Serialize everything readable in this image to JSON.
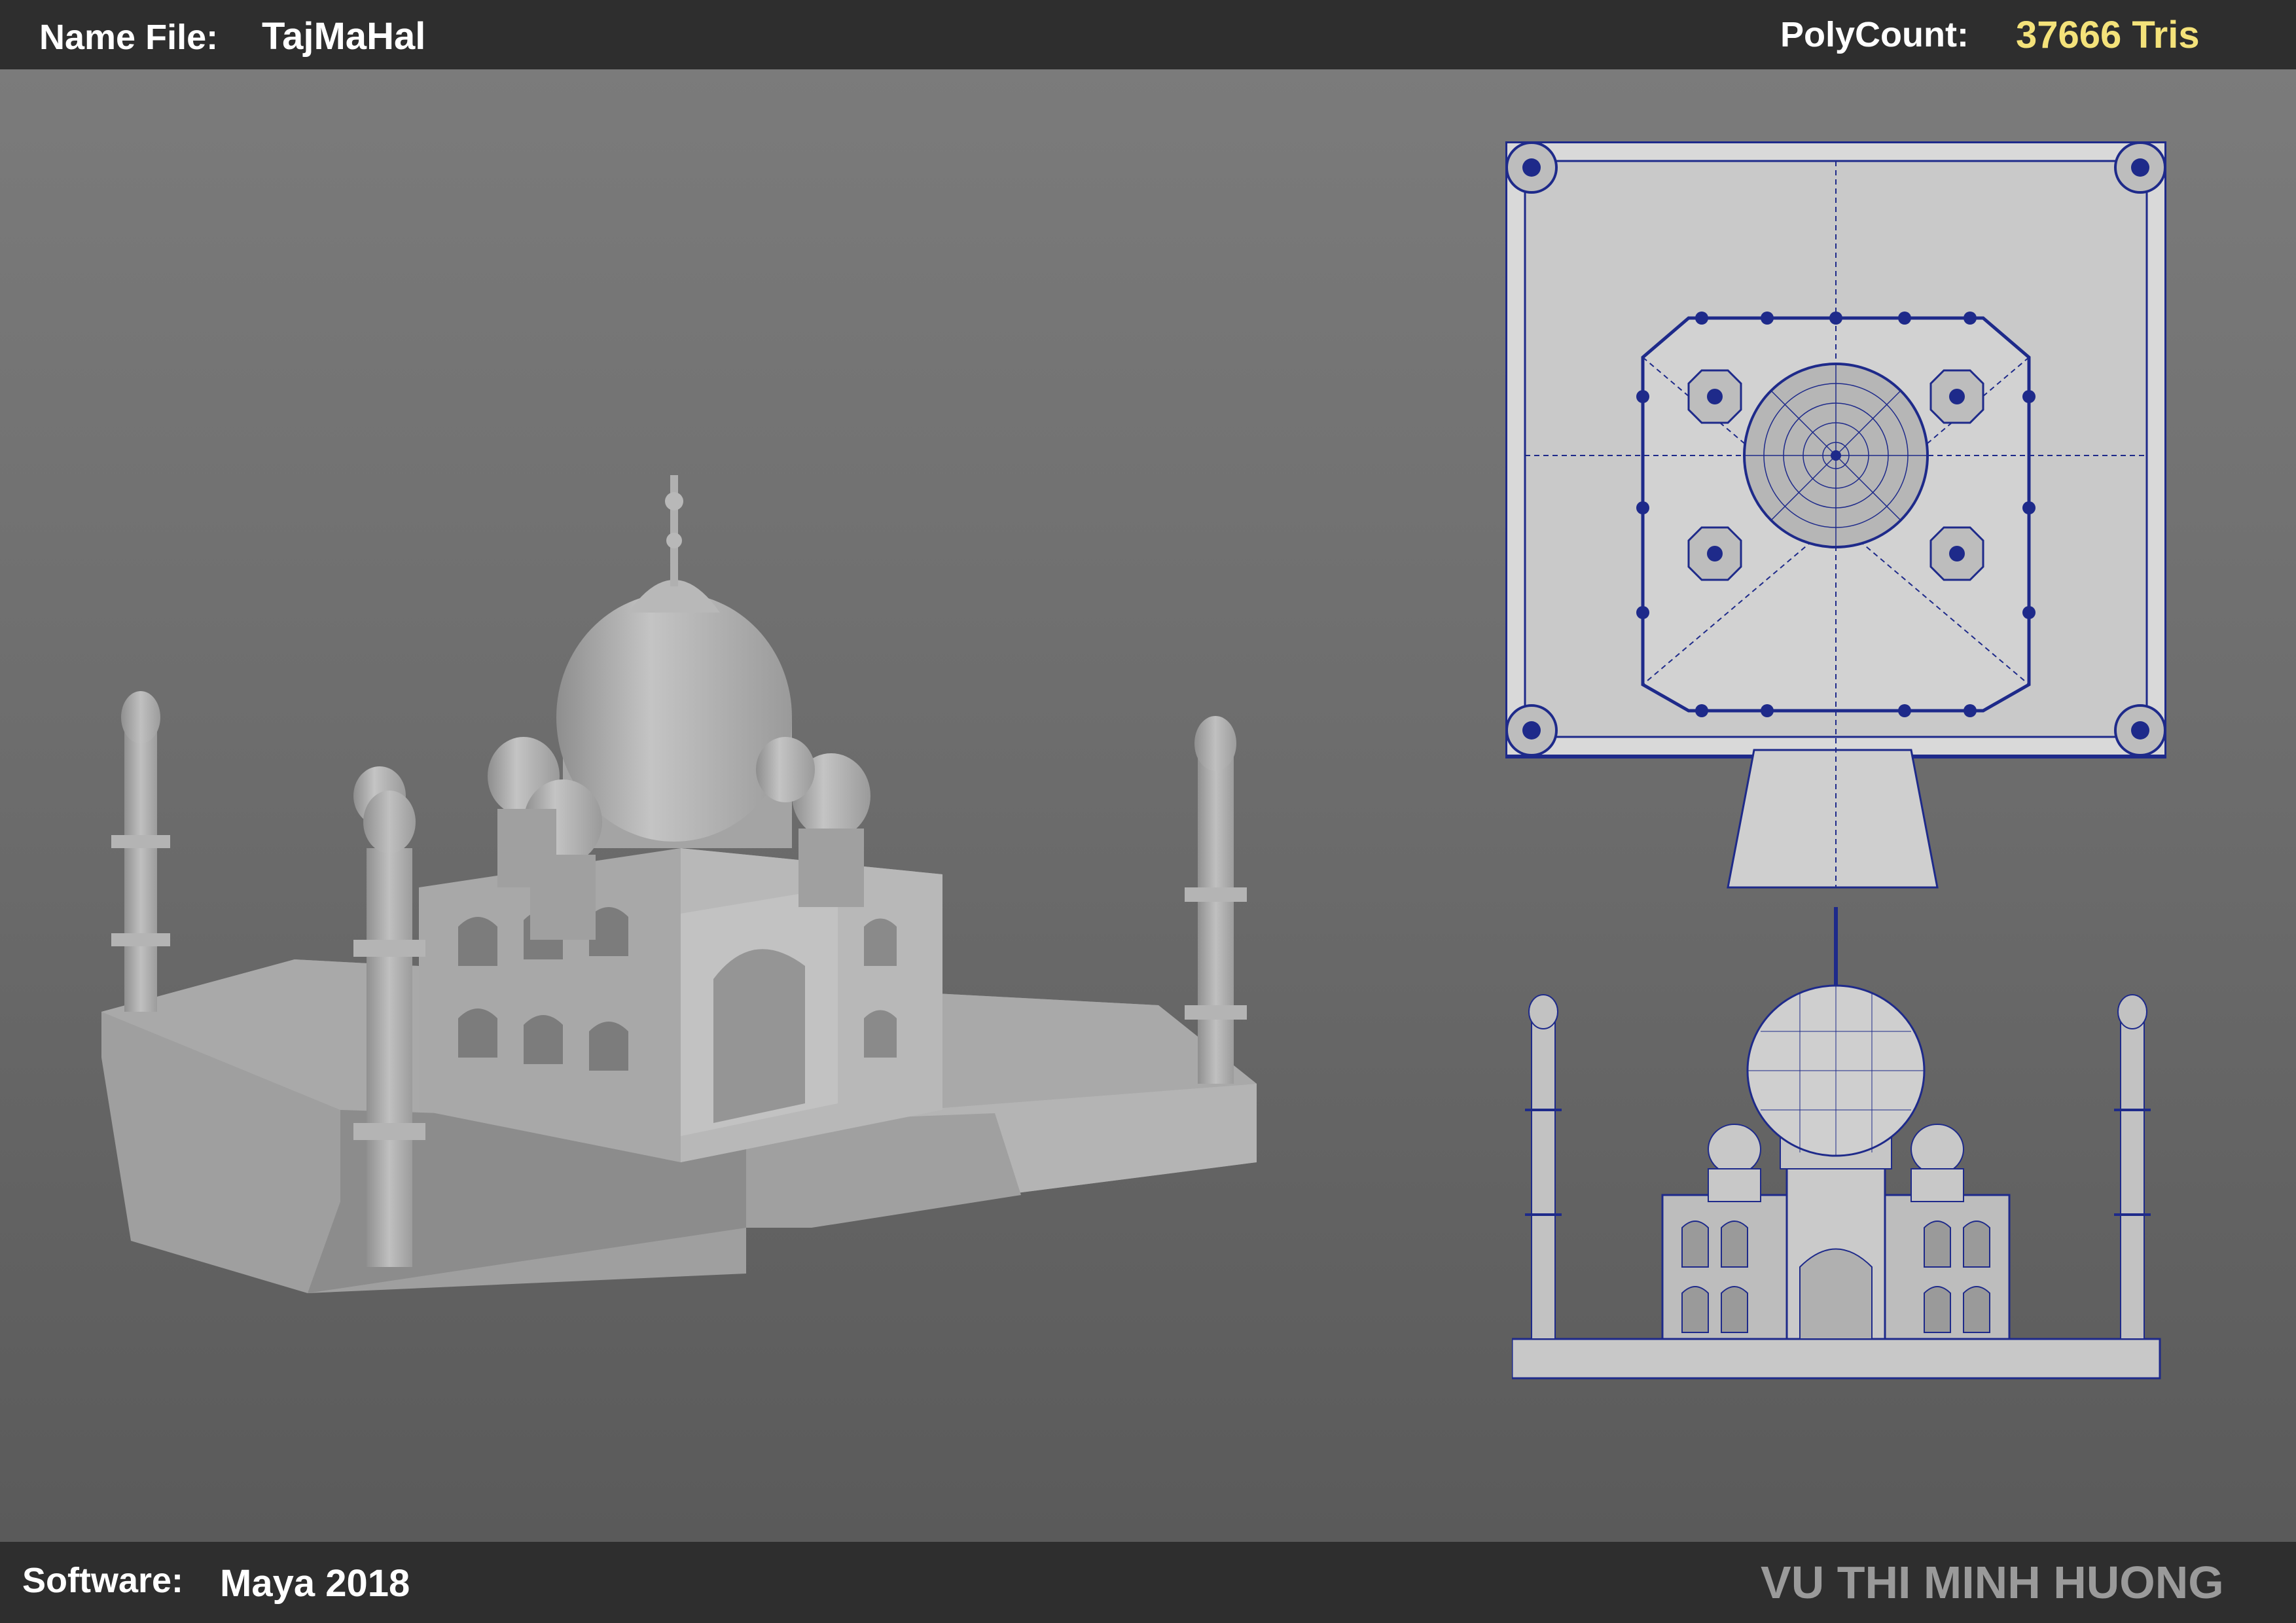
{
  "header": {
    "name_file_label": "Name File:",
    "name_file_value": "TajMaHal",
    "polycount_label": "PolyCount:",
    "polycount_value": "37666 Tris"
  },
  "footer": {
    "software_label": "Software:",
    "software_value": "Maya 2018",
    "author": "VU THI MINH HUONG"
  },
  "colors": {
    "bar_bg": "#2e2e2e",
    "viewport_bg": "#6f6f6f",
    "polycount": "#f4e27a",
    "author": "#9a9a9a",
    "wireframe": "#1e2a8a",
    "model_gray": "#b0b0b0"
  },
  "views": [
    {
      "name": "perspective-view"
    },
    {
      "name": "top-view"
    },
    {
      "name": "front-view"
    }
  ]
}
